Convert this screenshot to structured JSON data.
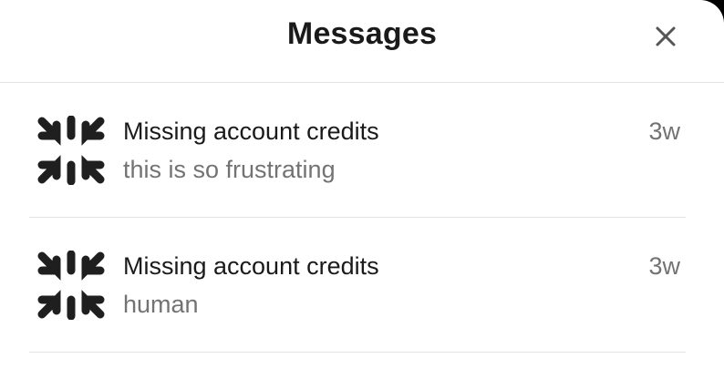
{
  "header": {
    "title": "Messages"
  },
  "icons": {
    "close": "close-icon",
    "avatar": "brand-logo-icon"
  },
  "colors": {
    "text_primary": "#1a1a1a",
    "text_secondary": "#737373",
    "divider": "#e3e3e3",
    "logo": "#1f1f1f"
  },
  "conversations": [
    {
      "title": "Missing account credits",
      "preview": "this is so frustrating",
      "time": "3w"
    },
    {
      "title": "Missing account credits",
      "preview": "human",
      "time": "3w"
    }
  ]
}
